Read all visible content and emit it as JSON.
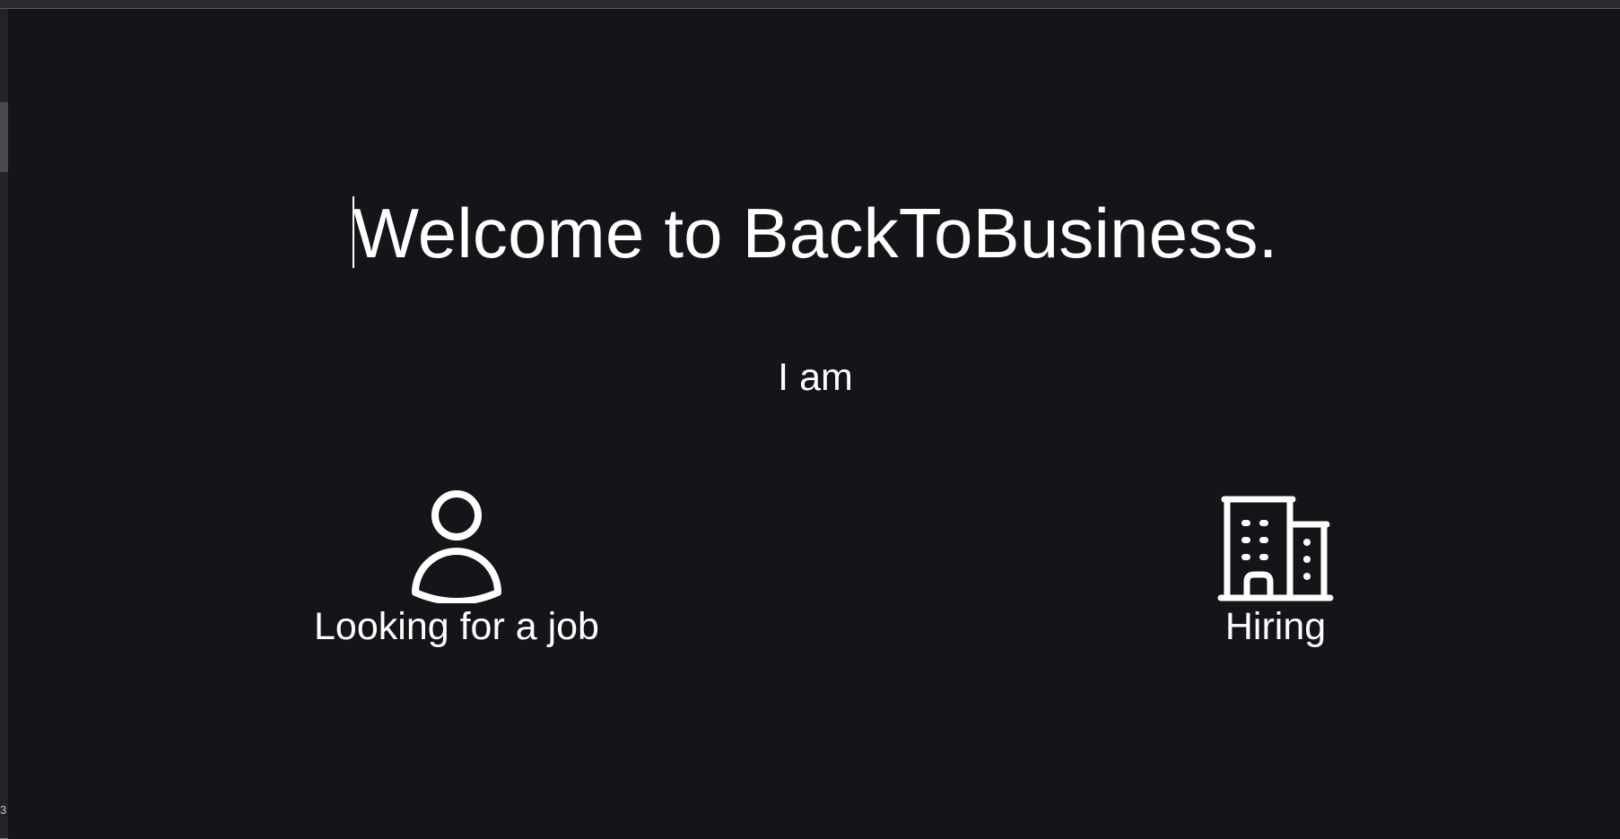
{
  "welcome": {
    "title": "Welcome to BackToBusiness.",
    "prompt": "I am"
  },
  "options": [
    {
      "label": "Looking for a job",
      "icon": "person-icon"
    },
    {
      "label": "Hiring",
      "icon": "building-icon"
    }
  ],
  "left_strip": {
    "mark": "3"
  },
  "colors": {
    "background": "#141519",
    "text": "#ffffff",
    "topbar": "#2a2b2f"
  }
}
